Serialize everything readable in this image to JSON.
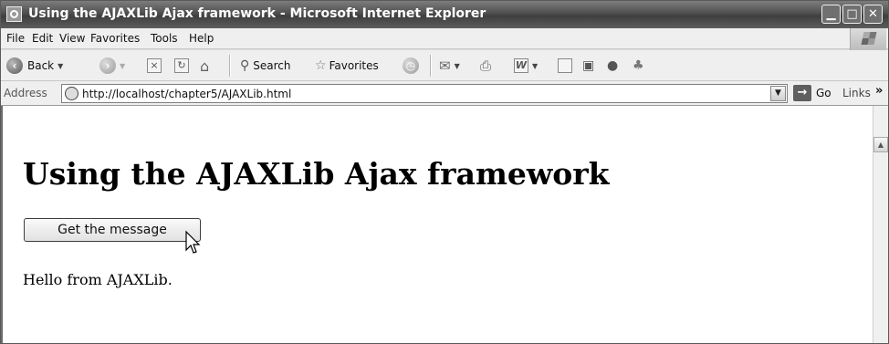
{
  "window": {
    "title": "Using the AJAXLib Ajax framework - Microsoft Internet Explorer",
    "controls": {
      "minimize": "▁",
      "maximize": "□",
      "close": "✕"
    }
  },
  "menu": [
    "File",
    "Edit",
    "View",
    "Favorites",
    "Tools",
    "Help"
  ],
  "toolbar": {
    "back_label": "Back",
    "search_label": "Search",
    "favorites_label": "Favorites",
    "icons": [
      "back-icon",
      "forward-icon",
      "stop-icon",
      "refresh-icon",
      "home-icon",
      "search-icon",
      "favorites-icon",
      "history-icon",
      "mail-icon",
      "print-icon",
      "edit-icon",
      "discuss-icon",
      "research-icon",
      "messenger-icon"
    ]
  },
  "address": {
    "label": "Address",
    "url": "http://localhost/chapter5/AJAXLib.html",
    "go_label": "Go",
    "links_label": "Links",
    "links_chevron": "»"
  },
  "page": {
    "heading": "Using the AJAXLib Ajax framework",
    "button_label": "Get the message",
    "message": "Hello from AJAXLib."
  }
}
